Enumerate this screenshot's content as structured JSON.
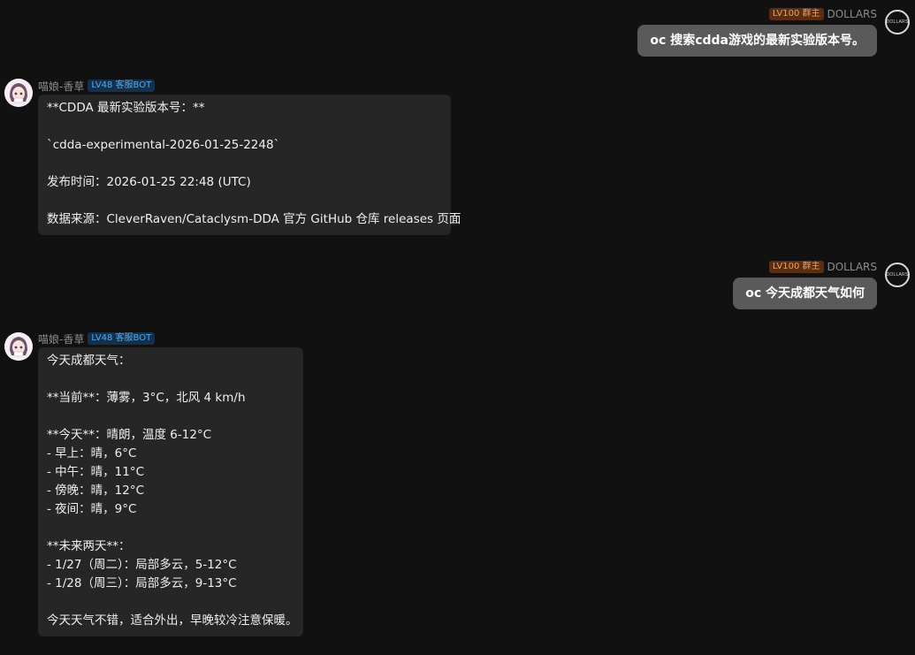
{
  "badges": {
    "admin": "LV100 群主",
    "bot": "LV48 客服BOT"
  },
  "users": {
    "self_name": "DOLLARS",
    "self_avatar_text": "DOLLARS",
    "bot_name": "喵娘-香草"
  },
  "messages": [
    {
      "role": "user",
      "text": "oc 搜索cdda游戏的最新实验版本号。"
    },
    {
      "role": "bot",
      "lines": [
        "**CDDA 最新实验版本号：**",
        "",
        "`cdda-experimental-2026-01-25-2248`",
        "",
        "发布时间：2026-01-25 22:48 (UTC)",
        "",
        "数据来源：CleverRaven/Cataclysm-DDA 官方 GitHub 仓库 releases 页面"
      ]
    },
    {
      "role": "user",
      "text": "oc 今天成都天气如何"
    },
    {
      "role": "bot",
      "lines": [
        "今天成都天气：",
        "",
        "**当前**：薄雾，3°C，北风 4 km/h",
        "",
        "**今天**：晴朗，温度 6-12°C",
        "- 早上：晴，6°C",
        "- 中午：晴，11°C",
        "- 傍晚：晴，12°C",
        "- 夜间：晴，9°C",
        "",
        "**未来两天**：",
        "- 1/27（周二）：局部多云，5-12°C",
        "- 1/28（周三）：局部多云，9-13°C",
        "",
        "今天天气不错，适合外出，早晚较冷注意保暖。"
      ]
    }
  ]
}
